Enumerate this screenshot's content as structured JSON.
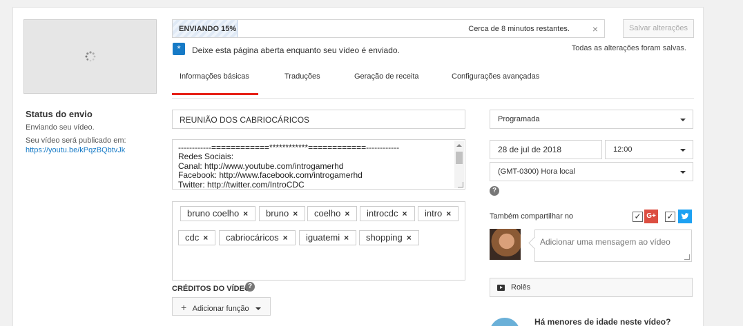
{
  "left": {
    "status_title": "Status do envio",
    "status_line": "Enviando seu vídeo.",
    "publish_label": "Seu vídeo será publicado em:",
    "publish_url": "https://youtu.be/kPqzBQbtvJk"
  },
  "progress": {
    "label": "ENVIANDO 15%",
    "percent": 15,
    "remaining": "Cerca de 8 minutos restantes.",
    "close": "×"
  },
  "save_button": "Salvar alterações",
  "notice": {
    "icon": "*",
    "text": "Deixe esta página aberta enquanto seu vídeo é enviado."
  },
  "saved_status": "Todas as alterações foram salvas.",
  "tabs": [
    {
      "label": "Informações básicas",
      "active": true
    },
    {
      "label": "Traduções"
    },
    {
      "label": "Geração de receita"
    },
    {
      "label": "Configurações avançadas"
    }
  ],
  "video": {
    "title": "REUNIÃO DOS CABRIOCÁRICOS",
    "description_lines": [
      "------------============************============------------",
      "Redes Sociais:",
      "Canal: http://www.youtube.com/introgamerhd",
      "Facebook: http://www.facebook.com/introgamerhd",
      "Twitter: http://twitter.com/IntroCDC"
    ]
  },
  "tags": [
    "bruno coelho",
    "bruno",
    "coelho",
    "introcdc",
    "intro",
    "cdc",
    "cabriocáricos",
    "iguatemi",
    "shopping"
  ],
  "tag_remove": "×",
  "credits": {
    "label": "CRÉDITOS DO VÍDEO",
    "help": "?",
    "add_role": "Adicionar função",
    "add_icon": "+"
  },
  "privacy": {
    "selected": "Programada"
  },
  "schedule": {
    "date": "28 de jul de 2018",
    "time": "12:00",
    "timezone": "(GMT-0300) Hora local",
    "help": "?"
  },
  "share": {
    "label": "Também compartilhar no",
    "google_plus": "G+",
    "check": "✓",
    "message_placeholder": "Adicionar uma mensagem ao vídeo"
  },
  "roles_button": "Rolês",
  "minors_question": "Há menores de idade neste vídeo?",
  "colors": {
    "accent_red": "#e62117",
    "link_blue": "#167ac6",
    "gplus_red": "#dc4e41",
    "twitter_blue": "#1da1f2"
  }
}
